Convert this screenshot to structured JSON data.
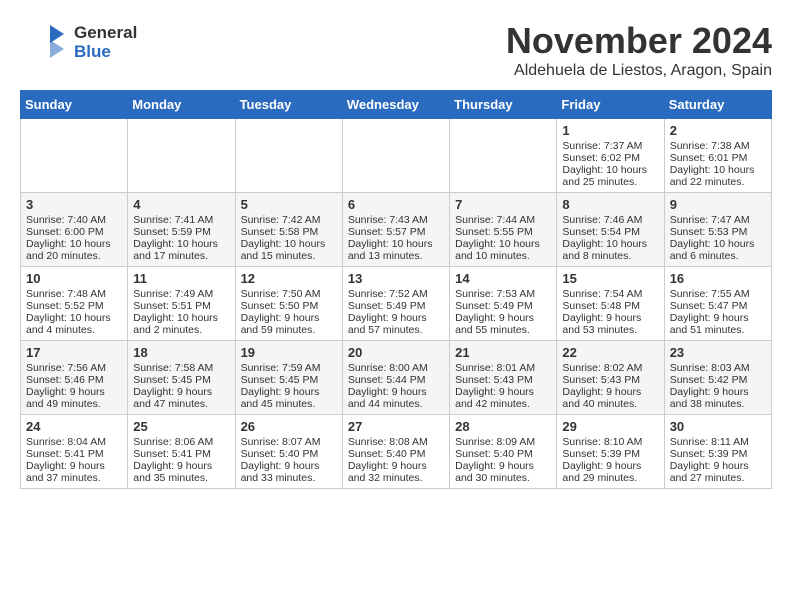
{
  "header": {
    "logo_general": "General",
    "logo_blue": "Blue",
    "month": "November 2024",
    "location": "Aldehuela de Liestos, Aragon, Spain"
  },
  "weekdays": [
    "Sunday",
    "Monday",
    "Tuesday",
    "Wednesday",
    "Thursday",
    "Friday",
    "Saturday"
  ],
  "weeks": [
    {
      "days": [
        {
          "num": "",
          "content": ""
        },
        {
          "num": "",
          "content": ""
        },
        {
          "num": "",
          "content": ""
        },
        {
          "num": "",
          "content": ""
        },
        {
          "num": "",
          "content": ""
        },
        {
          "num": "1",
          "content": "Sunrise: 7:37 AM\nSunset: 6:02 PM\nDaylight: 10 hours and 25 minutes."
        },
        {
          "num": "2",
          "content": "Sunrise: 7:38 AM\nSunset: 6:01 PM\nDaylight: 10 hours and 22 minutes."
        }
      ]
    },
    {
      "days": [
        {
          "num": "3",
          "content": "Sunrise: 7:40 AM\nSunset: 6:00 PM\nDaylight: 10 hours and 20 minutes."
        },
        {
          "num": "4",
          "content": "Sunrise: 7:41 AM\nSunset: 5:59 PM\nDaylight: 10 hours and 17 minutes."
        },
        {
          "num": "5",
          "content": "Sunrise: 7:42 AM\nSunset: 5:58 PM\nDaylight: 10 hours and 15 minutes."
        },
        {
          "num": "6",
          "content": "Sunrise: 7:43 AM\nSunset: 5:57 PM\nDaylight: 10 hours and 13 minutes."
        },
        {
          "num": "7",
          "content": "Sunrise: 7:44 AM\nSunset: 5:55 PM\nDaylight: 10 hours and 10 minutes."
        },
        {
          "num": "8",
          "content": "Sunrise: 7:46 AM\nSunset: 5:54 PM\nDaylight: 10 hours and 8 minutes."
        },
        {
          "num": "9",
          "content": "Sunrise: 7:47 AM\nSunset: 5:53 PM\nDaylight: 10 hours and 6 minutes."
        }
      ]
    },
    {
      "days": [
        {
          "num": "10",
          "content": "Sunrise: 7:48 AM\nSunset: 5:52 PM\nDaylight: 10 hours and 4 minutes."
        },
        {
          "num": "11",
          "content": "Sunrise: 7:49 AM\nSunset: 5:51 PM\nDaylight: 10 hours and 2 minutes."
        },
        {
          "num": "12",
          "content": "Sunrise: 7:50 AM\nSunset: 5:50 PM\nDaylight: 9 hours and 59 minutes."
        },
        {
          "num": "13",
          "content": "Sunrise: 7:52 AM\nSunset: 5:49 PM\nDaylight: 9 hours and 57 minutes."
        },
        {
          "num": "14",
          "content": "Sunrise: 7:53 AM\nSunset: 5:49 PM\nDaylight: 9 hours and 55 minutes."
        },
        {
          "num": "15",
          "content": "Sunrise: 7:54 AM\nSunset: 5:48 PM\nDaylight: 9 hours and 53 minutes."
        },
        {
          "num": "16",
          "content": "Sunrise: 7:55 AM\nSunset: 5:47 PM\nDaylight: 9 hours and 51 minutes."
        }
      ]
    },
    {
      "days": [
        {
          "num": "17",
          "content": "Sunrise: 7:56 AM\nSunset: 5:46 PM\nDaylight: 9 hours and 49 minutes."
        },
        {
          "num": "18",
          "content": "Sunrise: 7:58 AM\nSunset: 5:45 PM\nDaylight: 9 hours and 47 minutes."
        },
        {
          "num": "19",
          "content": "Sunrise: 7:59 AM\nSunset: 5:45 PM\nDaylight: 9 hours and 45 minutes."
        },
        {
          "num": "20",
          "content": "Sunrise: 8:00 AM\nSunset: 5:44 PM\nDaylight: 9 hours and 44 minutes."
        },
        {
          "num": "21",
          "content": "Sunrise: 8:01 AM\nSunset: 5:43 PM\nDaylight: 9 hours and 42 minutes."
        },
        {
          "num": "22",
          "content": "Sunrise: 8:02 AM\nSunset: 5:43 PM\nDaylight: 9 hours and 40 minutes."
        },
        {
          "num": "23",
          "content": "Sunrise: 8:03 AM\nSunset: 5:42 PM\nDaylight: 9 hours and 38 minutes."
        }
      ]
    },
    {
      "days": [
        {
          "num": "24",
          "content": "Sunrise: 8:04 AM\nSunset: 5:41 PM\nDaylight: 9 hours and 37 minutes."
        },
        {
          "num": "25",
          "content": "Sunrise: 8:06 AM\nSunset: 5:41 PM\nDaylight: 9 hours and 35 minutes."
        },
        {
          "num": "26",
          "content": "Sunrise: 8:07 AM\nSunset: 5:40 PM\nDaylight: 9 hours and 33 minutes."
        },
        {
          "num": "27",
          "content": "Sunrise: 8:08 AM\nSunset: 5:40 PM\nDaylight: 9 hours and 32 minutes."
        },
        {
          "num": "28",
          "content": "Sunrise: 8:09 AM\nSunset: 5:40 PM\nDaylight: 9 hours and 30 minutes."
        },
        {
          "num": "29",
          "content": "Sunrise: 8:10 AM\nSunset: 5:39 PM\nDaylight: 9 hours and 29 minutes."
        },
        {
          "num": "30",
          "content": "Sunrise: 8:11 AM\nSunset: 5:39 PM\nDaylight: 9 hours and 27 minutes."
        }
      ]
    }
  ]
}
